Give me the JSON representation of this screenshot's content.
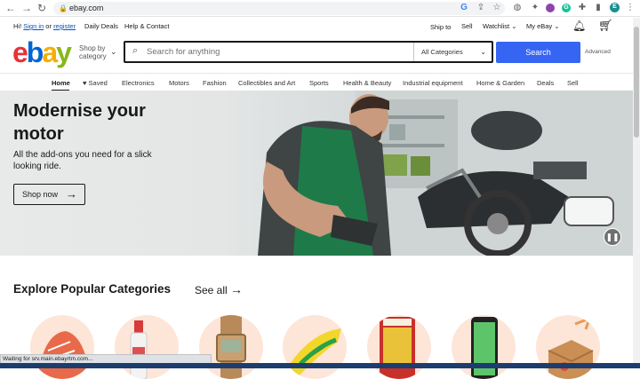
{
  "browser": {
    "url": "ebay.com",
    "back": "←",
    "forward": "→",
    "reload": "↻",
    "profile_initial": "E"
  },
  "topbar": {
    "greeting": "Hi!",
    "sign_in": "Sign in",
    "or": "or",
    "register": "register",
    "daily_deals": "Daily Deals",
    "help": "Help & Contact",
    "ship_to": "Ship to",
    "sell": "Sell",
    "watchlist": "Watchlist",
    "my_ebay": "My eBay"
  },
  "header": {
    "logo": {
      "e": "e",
      "b": "b",
      "a": "a",
      "y": "y"
    },
    "shop_by_line1": "Shop by",
    "shop_by_line2": "category",
    "search_placeholder": "Search for anything",
    "category_select": "All Categories",
    "search_button": "Search",
    "advanced": "Advanced"
  },
  "catnav": {
    "items": [
      "Home",
      "Saved",
      "Electronics",
      "Motors",
      "Fashion",
      "Collectibles and Art",
      "Sports",
      "Health & Beauty",
      "Industrial equipment",
      "Home & Garden",
      "Deals",
      "Sell"
    ]
  },
  "hero": {
    "title_line1": "Modernise your",
    "title_line2": "motor",
    "subtitle": "All the add-ons you need for a slick looking ride.",
    "cta": "Shop now"
  },
  "popular": {
    "title": "Explore Popular Categories",
    "see_all": "See all"
  },
  "status": {
    "text": "Waiting for srv.main.ebayrtm.com..."
  },
  "colors": {
    "accent": "#3665f3",
    "logo_e": "#e53238",
    "logo_b": "#0064d2",
    "logo_a": "#f5af02",
    "logo_y": "#86b817",
    "category_bg": "#fde5d8"
  }
}
